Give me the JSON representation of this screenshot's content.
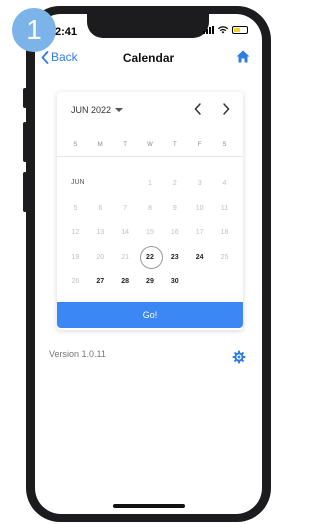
{
  "step_badge": "1",
  "status_bar": {
    "time": "2:41"
  },
  "nav": {
    "back_label": "Back",
    "title": "Calendar",
    "home_icon": "home-icon"
  },
  "calendar": {
    "month_selector": "JUN 2022",
    "prev_icon": "chevron-left-icon",
    "next_icon": "chevron-right-icon",
    "weekdays": [
      "S",
      "M",
      "T",
      "W",
      "T",
      "F",
      "S"
    ],
    "month_label": "JUN",
    "weeks": [
      [
        {
          "d": "",
          "s": "empty"
        },
        {
          "d": "",
          "s": "empty"
        },
        {
          "d": "",
          "s": "empty"
        },
        {
          "d": "1",
          "s": "disabled"
        },
        {
          "d": "2",
          "s": "disabled"
        },
        {
          "d": "3",
          "s": "disabled"
        },
        {
          "d": "4",
          "s": "disabled"
        }
      ],
      [
        {
          "d": "5",
          "s": "disabled"
        },
        {
          "d": "6",
          "s": "disabled"
        },
        {
          "d": "7",
          "s": "disabled"
        },
        {
          "d": "8",
          "s": "disabled"
        },
        {
          "d": "9",
          "s": "disabled"
        },
        {
          "d": "10",
          "s": "disabled"
        },
        {
          "d": "11",
          "s": "disabled"
        }
      ],
      [
        {
          "d": "12",
          "s": "disabled"
        },
        {
          "d": "13",
          "s": "disabled"
        },
        {
          "d": "14",
          "s": "disabled"
        },
        {
          "d": "15",
          "s": "disabled"
        },
        {
          "d": "16",
          "s": "disabled"
        },
        {
          "d": "17",
          "s": "disabled"
        },
        {
          "d": "18",
          "s": "disabled"
        }
      ],
      [
        {
          "d": "19",
          "s": "disabled"
        },
        {
          "d": "20",
          "s": "disabled"
        },
        {
          "d": "21",
          "s": "disabled"
        },
        {
          "d": "22",
          "s": "today"
        },
        {
          "d": "23",
          "s": "avail"
        },
        {
          "d": "24",
          "s": "avail"
        },
        {
          "d": "25",
          "s": "disabled"
        }
      ],
      [
        {
          "d": "26",
          "s": "disabled"
        },
        {
          "d": "27",
          "s": "avail"
        },
        {
          "d": "28",
          "s": "avail"
        },
        {
          "d": "29",
          "s": "avail"
        },
        {
          "d": "30",
          "s": "avail"
        },
        {
          "d": "",
          "s": "empty"
        },
        {
          "d": "",
          "s": "empty"
        }
      ]
    ],
    "go_button": "Go!"
  },
  "footer": {
    "version": "Version 1.0.11",
    "settings_icon": "gear-icon"
  },
  "colors": {
    "accent": "#3b88f5",
    "link": "#2f7de1",
    "badge": "#7cb3e8",
    "battery": "#f2d02f"
  }
}
